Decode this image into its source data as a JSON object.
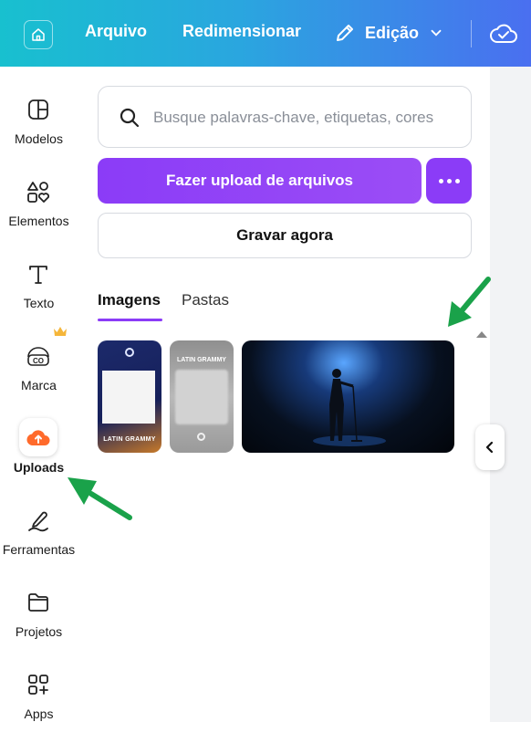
{
  "topbar": {
    "home_icon": "home-icon",
    "file_label": "Arquivo",
    "resize_label": "Redimensionar",
    "edit_icon": "pencil-icon",
    "edit_label": "Edição",
    "chevron_icon": "chevron-down-icon",
    "cloud_icon": "cloud-check-icon"
  },
  "sidebar": {
    "items": [
      {
        "label": "Modelos",
        "icon": "templates-icon"
      },
      {
        "label": "Elementos",
        "icon": "elements-icon"
      },
      {
        "label": "Texto",
        "icon": "text-icon"
      },
      {
        "label": "Marca",
        "icon": "brand-icon",
        "badge_icon": "crown-icon"
      },
      {
        "label": "Uploads",
        "icon": "upload-cloud-icon",
        "active": true
      },
      {
        "label": "Ferramentas",
        "icon": "tools-icon"
      },
      {
        "label": "Projetos",
        "icon": "folder-icon"
      },
      {
        "label": "Apps",
        "icon": "apps-icon"
      }
    ]
  },
  "panel": {
    "search": {
      "placeholder": "Busque palavras-chave, etiquetas, cores"
    },
    "upload_button": "Fazer upload de arquivos",
    "more_button_icon": "more-horizontal-icon",
    "record_button": "Gravar agora",
    "tabs": [
      {
        "label": "Imagens",
        "active": true
      },
      {
        "label": "Pastas",
        "active": false
      }
    ],
    "thumbnails": [
      {
        "lines": [
          "LATIN GRAMMY"
        ]
      },
      {
        "lines": [
          "LATIN GRAMMY"
        ]
      },
      {
        "lines": []
      }
    ]
  },
  "colors": {
    "accent_purple": "#8b3cf7",
    "topbar_start": "#18c0cf",
    "topbar_end": "#4a6ff0",
    "upload_orange": "#ff6a2b",
    "annotation_green": "#1aa24a"
  }
}
